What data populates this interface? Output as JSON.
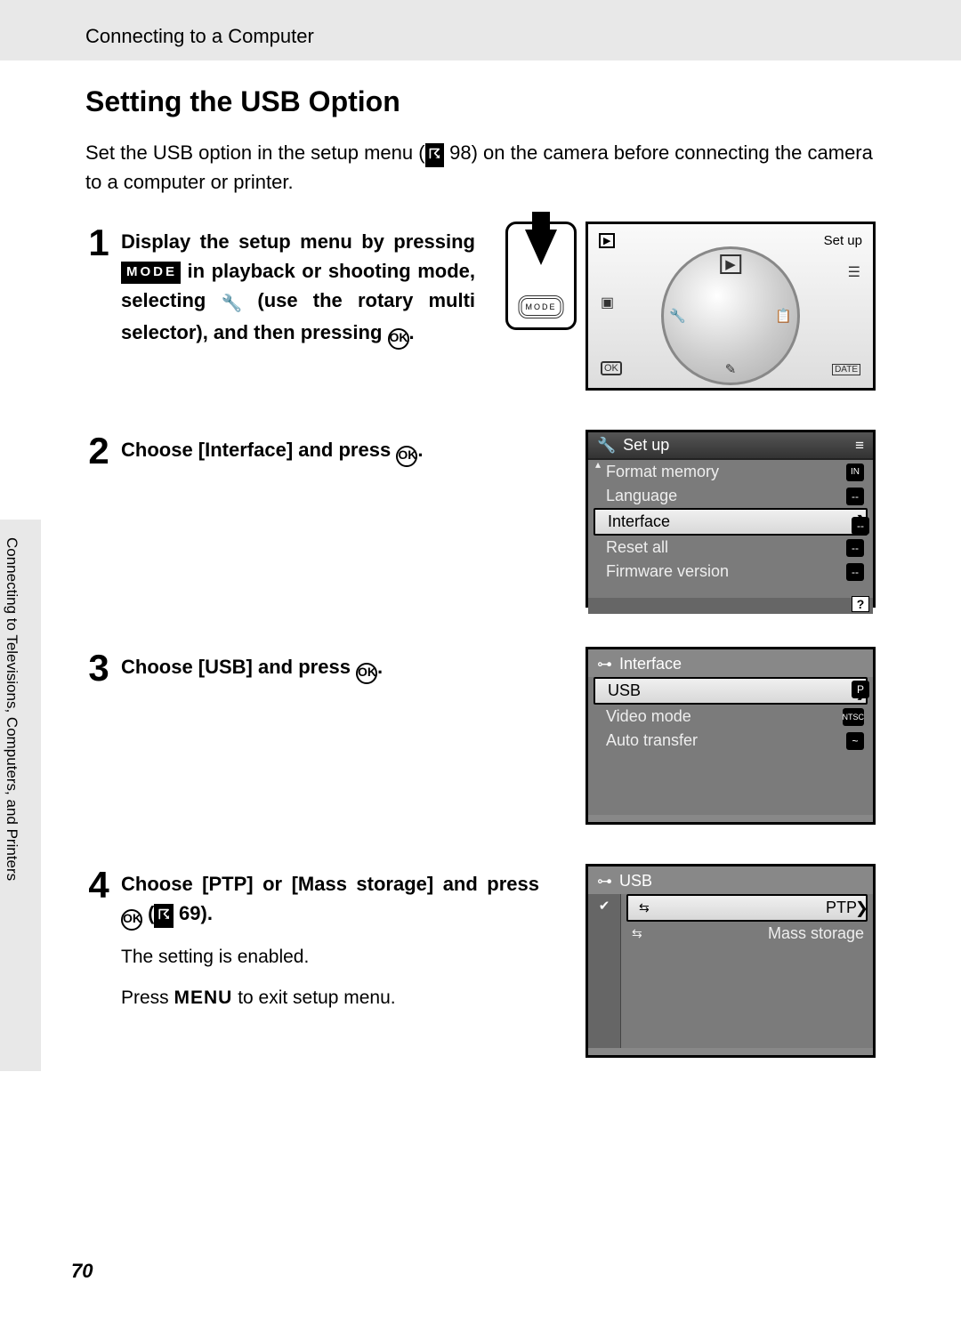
{
  "header": "Connecting to a Computer",
  "title": "Setting the USB Option",
  "intro_before_ref": "Set the USB option in the setup menu (",
  "intro_ref": " 98",
  "intro_after_ref": ") on the camera before connecting the camera to a computer or printer.",
  "side_tab": "Connecting to Televisions, Computers, and Printers",
  "page_number": "70",
  "mode_label": "MODE",
  "ok_label": "OK",
  "menu_label": "MENU",
  "steps": {
    "s1": {
      "num": "1",
      "txt_a": "Display the setup menu by pressing ",
      "txt_b": " in playback or shooting mode, selecting ",
      "txt_c": " (use the rotary multi selector), and then pressing ",
      "txt_d": ".",
      "rotary_label": "Set up",
      "ok_small": "OK",
      "date_small": "DATE"
    },
    "s2": {
      "num": "2",
      "txt_a": "Choose [Interface] and press ",
      "txt_b": ".",
      "lcd": {
        "title": "Set up",
        "rows": [
          "Format memory",
          "Language",
          "Interface",
          "Reset all",
          "Firmware version"
        ],
        "selected": "Interface",
        "side": [
          "IN",
          "--",
          "--",
          "--",
          "--"
        ]
      }
    },
    "s3": {
      "num": "3",
      "txt_a": "Choose [USB] and press ",
      "txt_b": ".",
      "lcd": {
        "title": "Interface",
        "rows": [
          "USB",
          "Video mode",
          "Auto transfer"
        ],
        "selected": "USB",
        "side_labels": [
          "P",
          "NTSC",
          "~"
        ]
      }
    },
    "s4": {
      "num": "4",
      "txt_a": "Choose [PTP] or [Mass storage] and press ",
      "txt_b": " (",
      "txt_c": " 69).",
      "sub1": "The setting is enabled.",
      "sub2_a": "Press ",
      "sub2_b": " to exit setup menu.",
      "lcd": {
        "title": "USB",
        "rows": [
          "PTP",
          "Mass storage"
        ],
        "selected": "PTP"
      }
    }
  }
}
